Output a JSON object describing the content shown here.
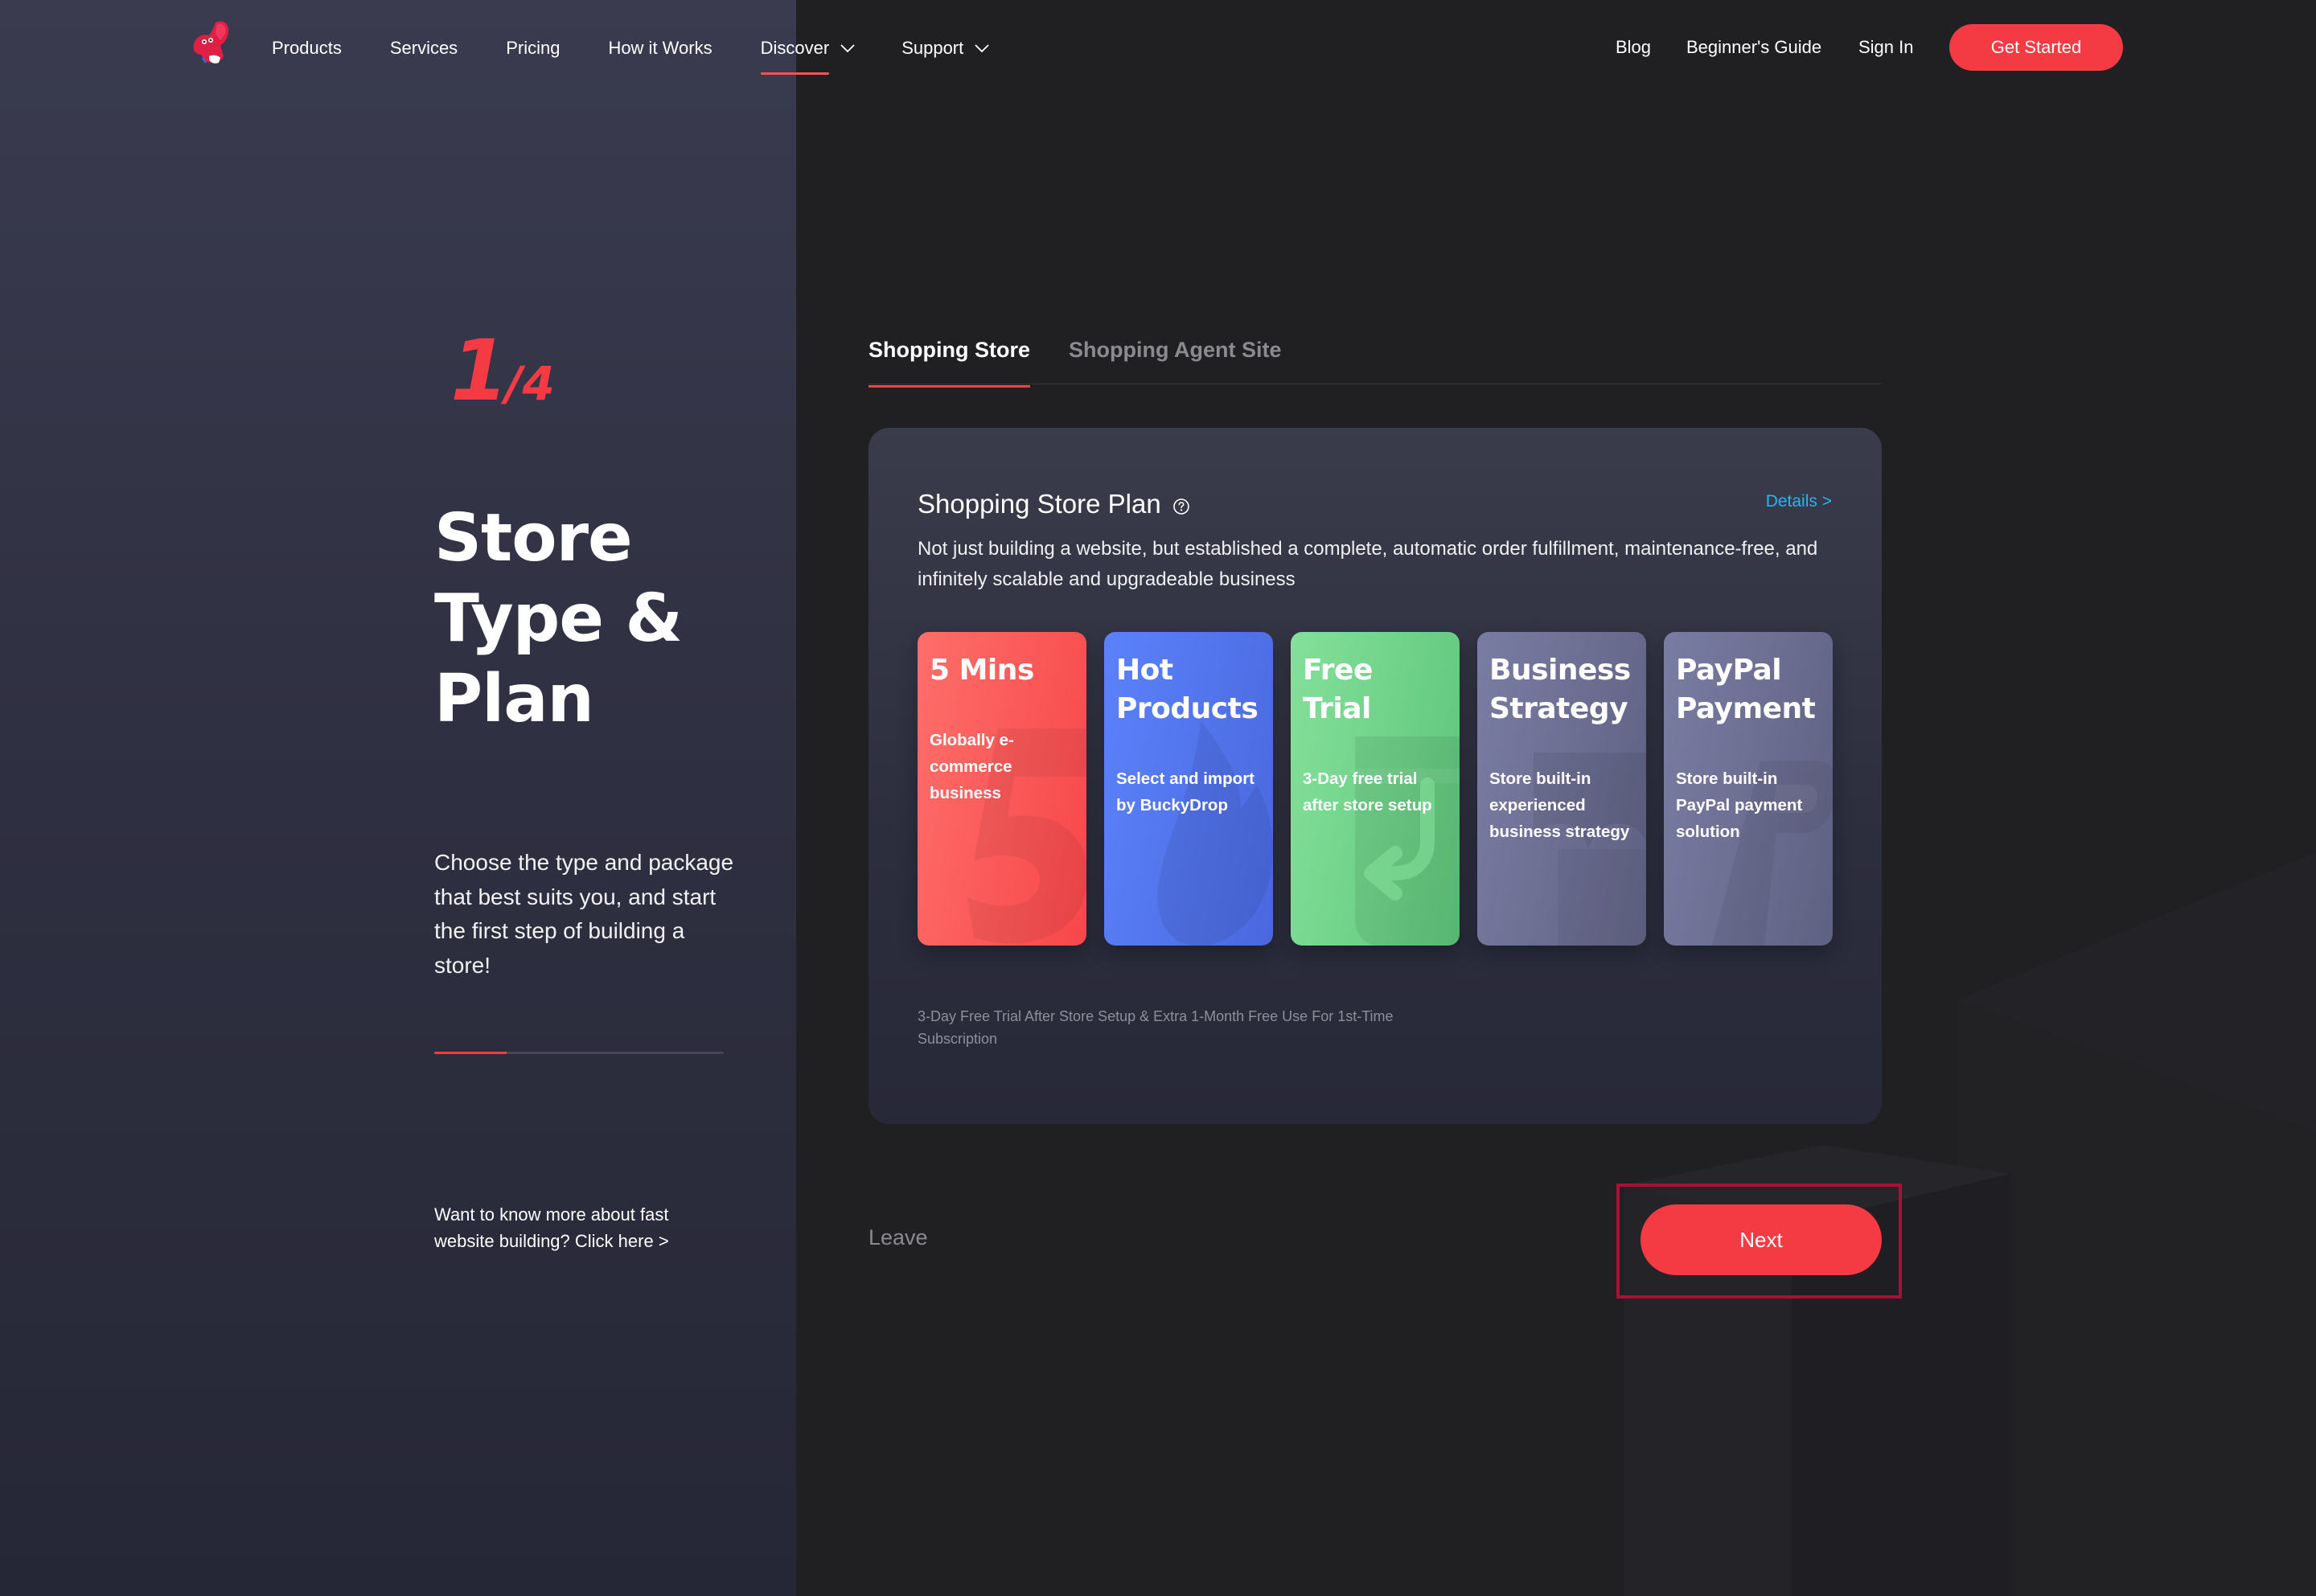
{
  "header": {
    "logo_alt": "mascot-logo",
    "nav_left": [
      {
        "label": "Products",
        "dropdown": false,
        "active": false
      },
      {
        "label": "Services",
        "dropdown": false,
        "active": false
      },
      {
        "label": "Pricing",
        "dropdown": false,
        "active": false
      },
      {
        "label": "How it Works",
        "dropdown": false,
        "active": false
      },
      {
        "label": "Discover",
        "dropdown": true,
        "active": true
      },
      {
        "label": "Support",
        "dropdown": true,
        "active": false
      }
    ],
    "nav_right": [
      {
        "label": "Blog"
      },
      {
        "label": "Beginner's Guide"
      },
      {
        "label": "Sign In"
      }
    ],
    "cta_label": "Get Started"
  },
  "sidebar": {
    "step_current": "1",
    "step_total": "/4",
    "title": "Store Type & Plan",
    "description": "Choose the type and package that best suits you, and start the first step of building a store!",
    "progress_fraction": 0.25,
    "learn_more": "Want to know more about fast website building? Click here >"
  },
  "tabs": [
    {
      "label": "Shopping Store",
      "active": true
    },
    {
      "label": "Shopping Agent Site",
      "active": false
    }
  ],
  "plan": {
    "title": "Shopping Store Plan",
    "help_icon": "question-circle-icon",
    "details_label": "Details >",
    "description": "Not just building a website, but established a complete, automatic order fulfillment, maintenance-free, and infinitely scalable and upgradeable business",
    "features": [
      {
        "title": "5 Mins",
        "desc": "Globally e-commerce business",
        "color": "#f7474a",
        "icon": "number-five-icon"
      },
      {
        "title": "Hot Products",
        "desc": "Select and import by BuckyDrop",
        "color": "#5677f0",
        "icon": "flame-icon"
      },
      {
        "title": "Free Trial",
        "desc": "3-Day free trial after store setup",
        "color": "#6ed38a",
        "icon": "return-arrow-icon"
      },
      {
        "title": "Business Strategy",
        "desc": "Store built-in experienced business strategy",
        "color": "#6e7195",
        "icon": "storefront-awning-icon"
      },
      {
        "title": "PayPal Payment",
        "desc": "Store built-in PayPal payment solution",
        "color": "#6e7195",
        "icon": "paypal-icon"
      }
    ],
    "note": "3-Day Free Trial After Store Setup & Extra 1-Month Free Use For 1st-Time Subscription"
  },
  "actions": {
    "leave_label": "Leave",
    "next_label": "Next"
  },
  "colors": {
    "accent": "#f43b43",
    "link": "#1fb8f0",
    "highlight_border": "#a90f37"
  }
}
